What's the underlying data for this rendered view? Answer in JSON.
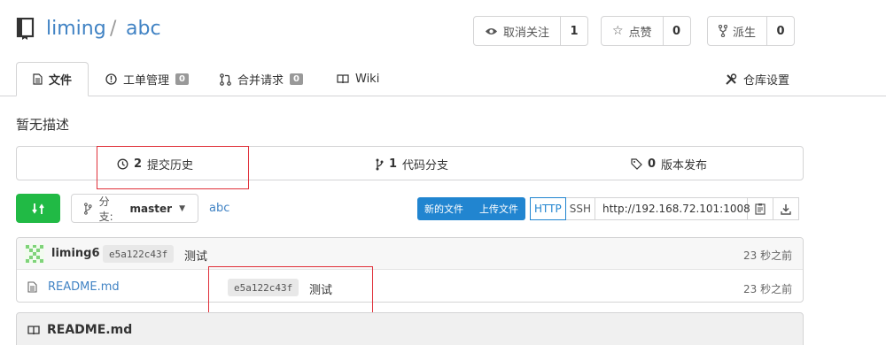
{
  "repo": {
    "owner": "liming",
    "separator": "/",
    "name": "abc"
  },
  "actions": [
    {
      "label": "取消关注",
      "count": "1"
    },
    {
      "label": "点赞",
      "count": "0"
    },
    {
      "label": "派生",
      "count": "0"
    }
  ],
  "tabs": [
    {
      "label": "文件"
    },
    {
      "label": "工单管理",
      "badge": "0"
    },
    {
      "label": "合并请求",
      "badge": "0"
    },
    {
      "label": "Wiki"
    }
  ],
  "settings_label": "仓库设置",
  "description": "暂无描述",
  "stats": {
    "commits": {
      "count": "2",
      "label": "提交历史"
    },
    "branches": {
      "count": "1",
      "label": "代码分支"
    },
    "releases": {
      "count": "0",
      "label": "版本发布"
    }
  },
  "branch": {
    "prefix": "分支:",
    "name": "master"
  },
  "breadcrumb": "abc",
  "buttons": {
    "new_file": "新的文件",
    "upload_file": "上传文件"
  },
  "clone": {
    "http": "HTTP",
    "ssh": "SSH",
    "url": "http://192.168.72.101:1008"
  },
  "latest_commit": {
    "author": "liming6",
    "sha": "e5a122c43f",
    "message": "测试",
    "time": "23 秒之前"
  },
  "files": [
    {
      "name": "README.md",
      "sha": "e5a122c43f",
      "message": "测试",
      "time": "23 秒之前"
    }
  ],
  "readme_title": "README.md",
  "colors": {
    "link": "#4183c4",
    "green": "#21ba45",
    "blue": "#2185d0",
    "highlight": "#e0303a"
  }
}
